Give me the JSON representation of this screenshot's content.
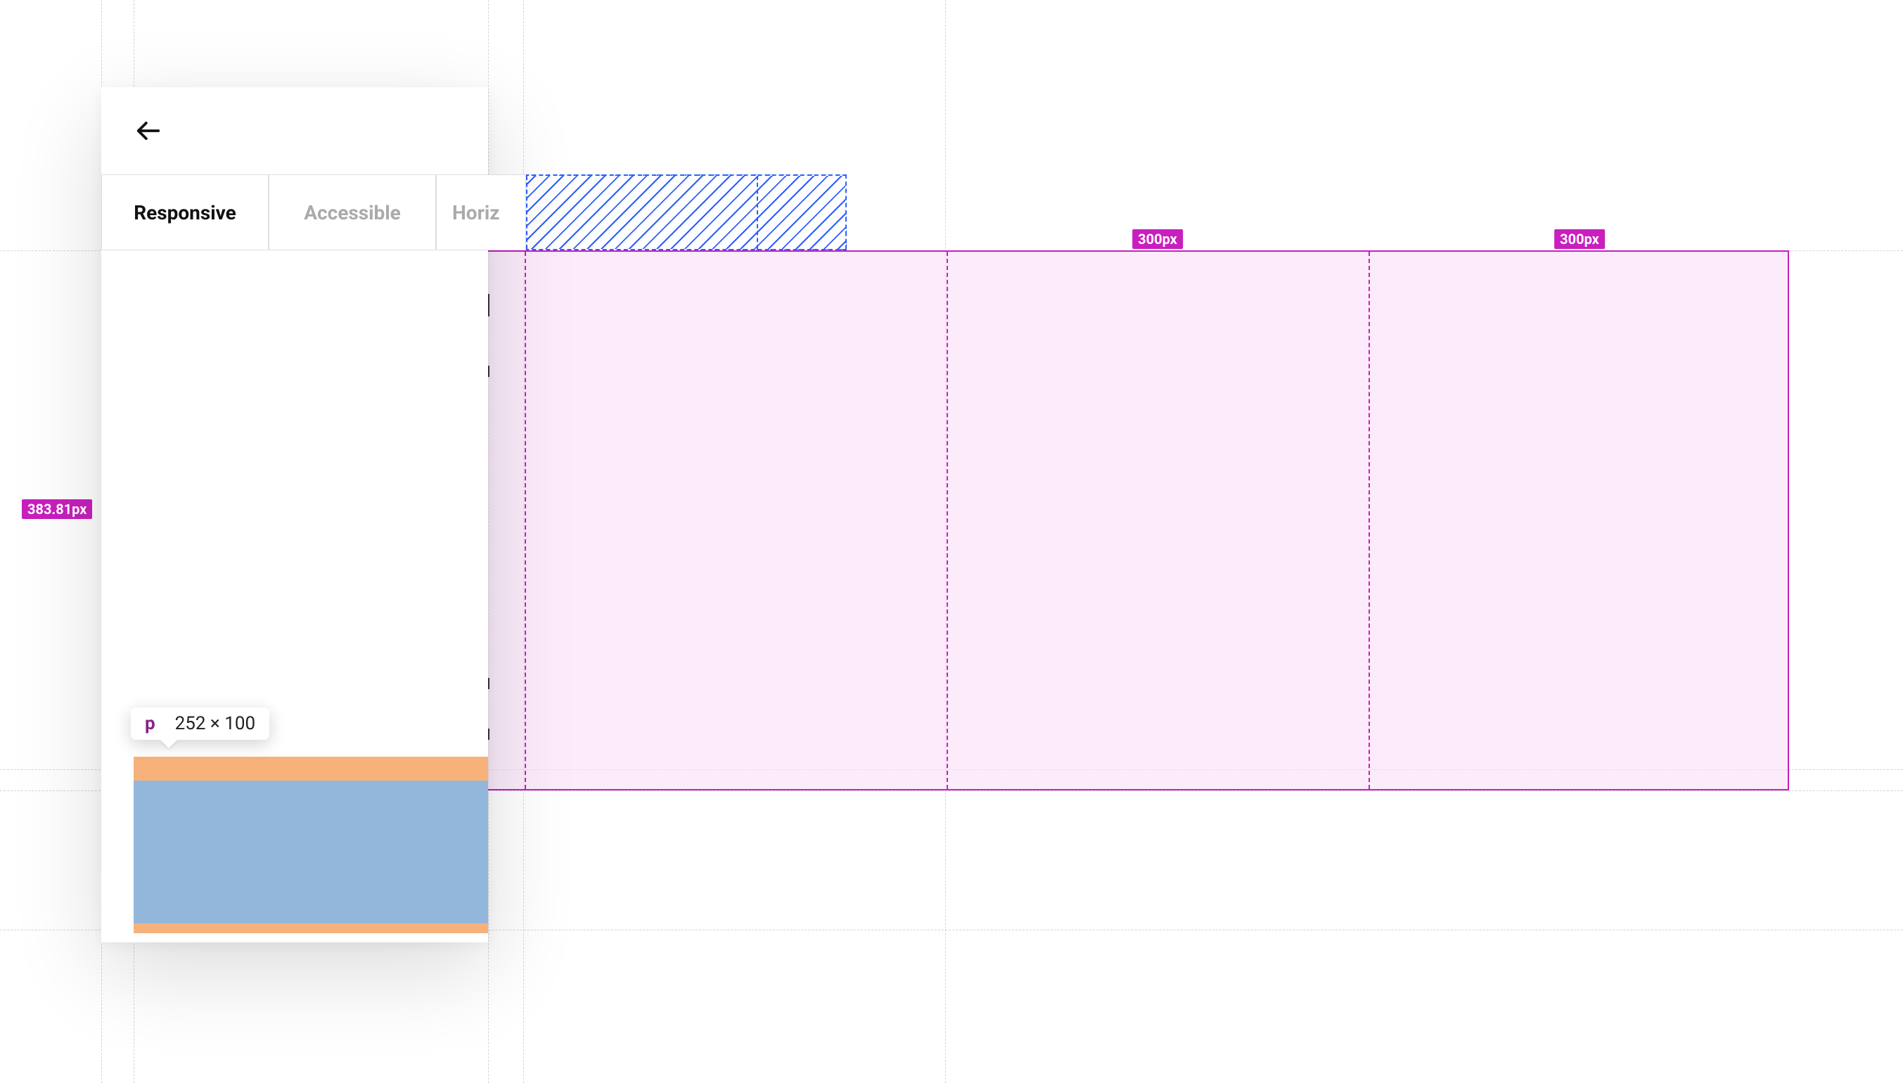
{
  "tabs": {
    "items": [
      {
        "label": "Responsive",
        "active": true
      },
      {
        "label": "Accessible",
        "active": false
      },
      {
        "label": "Horizontal",
        "active": false,
        "visible_text": "Horiz"
      }
    ]
  },
  "inspector": {
    "column_width_label": "300px",
    "container_height_label": "383.81px",
    "tooltip": {
      "tag": "p",
      "dimensions": "252 × 100"
    }
  },
  "colors": {
    "pink": "#c81fbe",
    "blue_hatch": "#2a5fff",
    "redaction_bar": "#3a2f3c",
    "margin_highlight": "#f6b27a",
    "content_highlight": "#93b6db"
  }
}
